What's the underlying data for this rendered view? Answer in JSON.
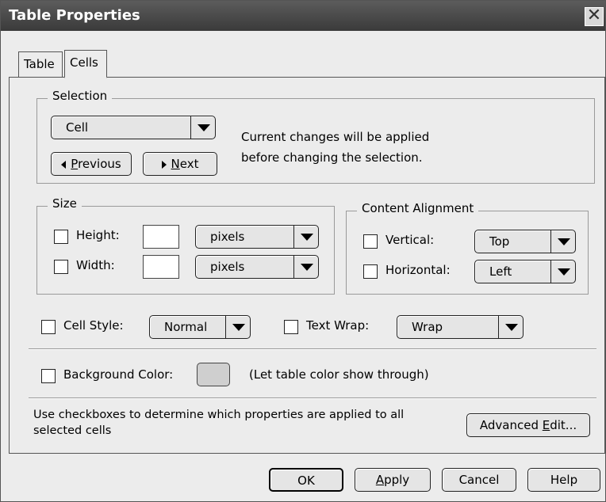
{
  "window": {
    "title": "Table Properties",
    "close_glyph": "✕"
  },
  "tabs": [
    {
      "label": "Table"
    },
    {
      "label": "Cells"
    }
  ],
  "selection": {
    "legend": "Selection",
    "dropdown_value": "Cell",
    "previous_label": "Previous",
    "next_label": "Next",
    "info_line1": "Current changes will be applied",
    "info_line2": "before changing the selection."
  },
  "size": {
    "legend": "Size",
    "height_label": "Height:",
    "height_value": "",
    "height_unit": "pixels",
    "width_label": "Width:",
    "width_value": "",
    "width_unit": "pixels"
  },
  "alignment": {
    "legend": "Content Alignment",
    "vertical_label": "Vertical:",
    "vertical_value": "Top",
    "horizontal_label": "Horizontal:",
    "horizontal_value": "Left"
  },
  "cell_style": {
    "label": "Cell Style:",
    "value": "Normal"
  },
  "text_wrap": {
    "label": "Text Wrap:",
    "value": "Wrap"
  },
  "background": {
    "label": "Background Color:",
    "note": "(Let table color show through)"
  },
  "help_text": {
    "line1": "Use checkboxes to determine which properties are applied to all",
    "line2": "selected cells"
  },
  "advanced_edit_label_pre": "Advanced ",
  "advanced_edit_label_key": "E",
  "advanced_edit_label_post": "dit...",
  "buttons": {
    "ok": "OK",
    "apply_key": "A",
    "apply_rest": "pply",
    "cancel": "Cancel",
    "help": "Help"
  },
  "mnemonics": {
    "previous_key": "P",
    "previous_rest": "revious",
    "next_key": "N",
    "next_rest": "ext"
  }
}
